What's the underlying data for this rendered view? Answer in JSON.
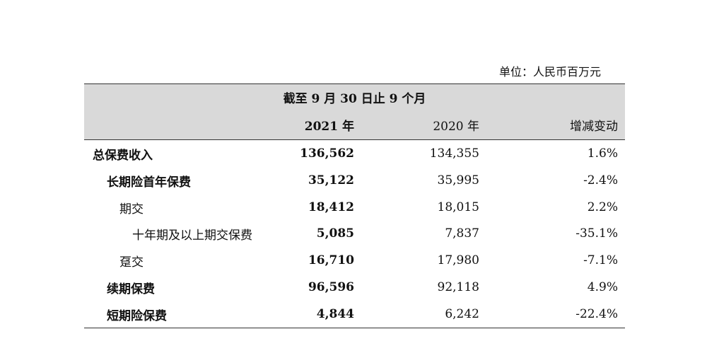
{
  "unit": "单位：人民币百万元",
  "header": {
    "period": "截至 9 月 30 日止 9 个月",
    "col1": "2021 年",
    "col2": "2020 年",
    "col3": "增减变动"
  },
  "rows": [
    {
      "label": "总保费收入",
      "v2021": "136,562",
      "v2020": "134,355",
      "change": "1.6%"
    },
    {
      "label": "长期险首年保费",
      "v2021": "35,122",
      "v2020": "35,995",
      "change": "-2.4%"
    },
    {
      "label": "期交",
      "v2021": "18,412",
      "v2020": "18,015",
      "change": "2.2%"
    },
    {
      "label": "十年期及以上期交保费",
      "v2021": "5,085",
      "v2020": "7,837",
      "change": "-35.1%"
    },
    {
      "label": "趸交",
      "v2021": "16,710",
      "v2020": "17,980",
      "change": "-7.1%"
    },
    {
      "label": "续期保费",
      "v2021": "96,596",
      "v2020": "92,118",
      "change": "4.9%"
    },
    {
      "label": "短期险保费",
      "v2021": "4,844",
      "v2020": "6,242",
      "change": "-22.4%"
    }
  ]
}
